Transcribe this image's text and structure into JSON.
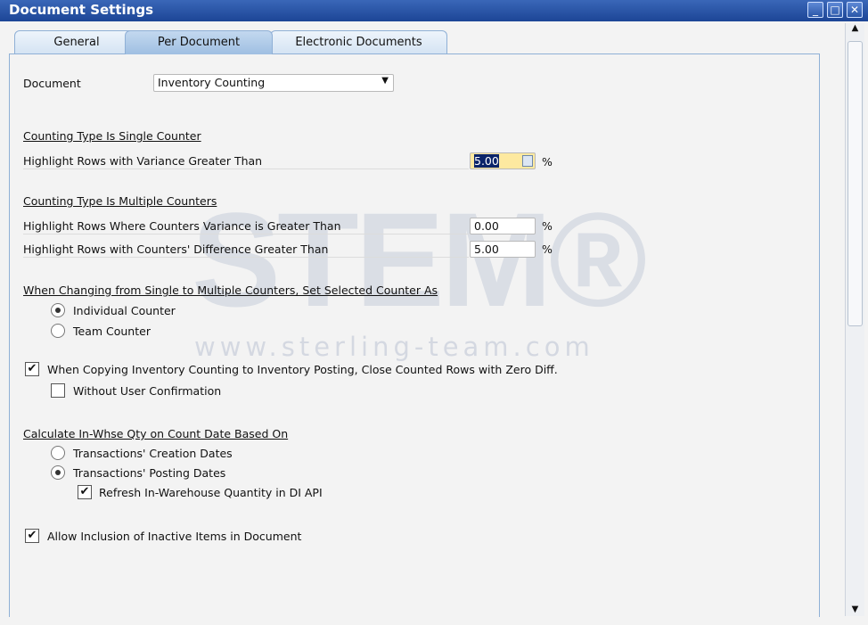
{
  "window": {
    "title": "Document Settings"
  },
  "tabs": [
    {
      "label": "General"
    },
    {
      "label": "Per Document"
    },
    {
      "label": "Electronic Documents"
    }
  ],
  "document": {
    "label": "Document",
    "value": "Inventory Counting"
  },
  "single": {
    "header": "Counting Type Is Single Counter",
    "variance_label": "Highlight Rows with Variance Greater Than",
    "variance_value": "5.00",
    "unit": "%"
  },
  "multiple": {
    "header": "Counting Type Is Multiple Counters",
    "variance_label": "Highlight Rows Where Counters Variance is Greater Than",
    "variance_value": "0.00",
    "difference_label": "Highlight Rows with Counters' Difference Greater Than",
    "difference_value": "5.00",
    "unit": "%"
  },
  "changing": {
    "header": "When Changing from Single to Multiple Counters, Set Selected Counter As",
    "options": [
      {
        "label": "Individual Counter",
        "selected": true
      },
      {
        "label": "Team Counter",
        "selected": false
      }
    ]
  },
  "copying": {
    "label": "When Copying Inventory Counting to Inventory Posting, Close Counted Rows with Zero Diff.",
    "checked": true,
    "sub_label": "Without User Confirmation",
    "sub_checked": false
  },
  "calculate": {
    "header": "Calculate In-Whse Qty on Count Date Based On",
    "options": [
      {
        "label": "Transactions' Creation Dates",
        "selected": false
      },
      {
        "label": "Transactions' Posting Dates",
        "selected": true
      }
    ],
    "refresh_label": "Refresh In-Warehouse Quantity in DI API",
    "refresh_checked": true
  },
  "inactive": {
    "label": "Allow Inclusion of Inactive Items in Document",
    "checked": true
  },
  "watermark": {
    "logo": "STEM®",
    "url": "www.sterling-team.com"
  },
  "colors": {
    "titlebar": "#1c4596",
    "highlight_field": "#fde9a0",
    "selection": "#0a246a"
  }
}
